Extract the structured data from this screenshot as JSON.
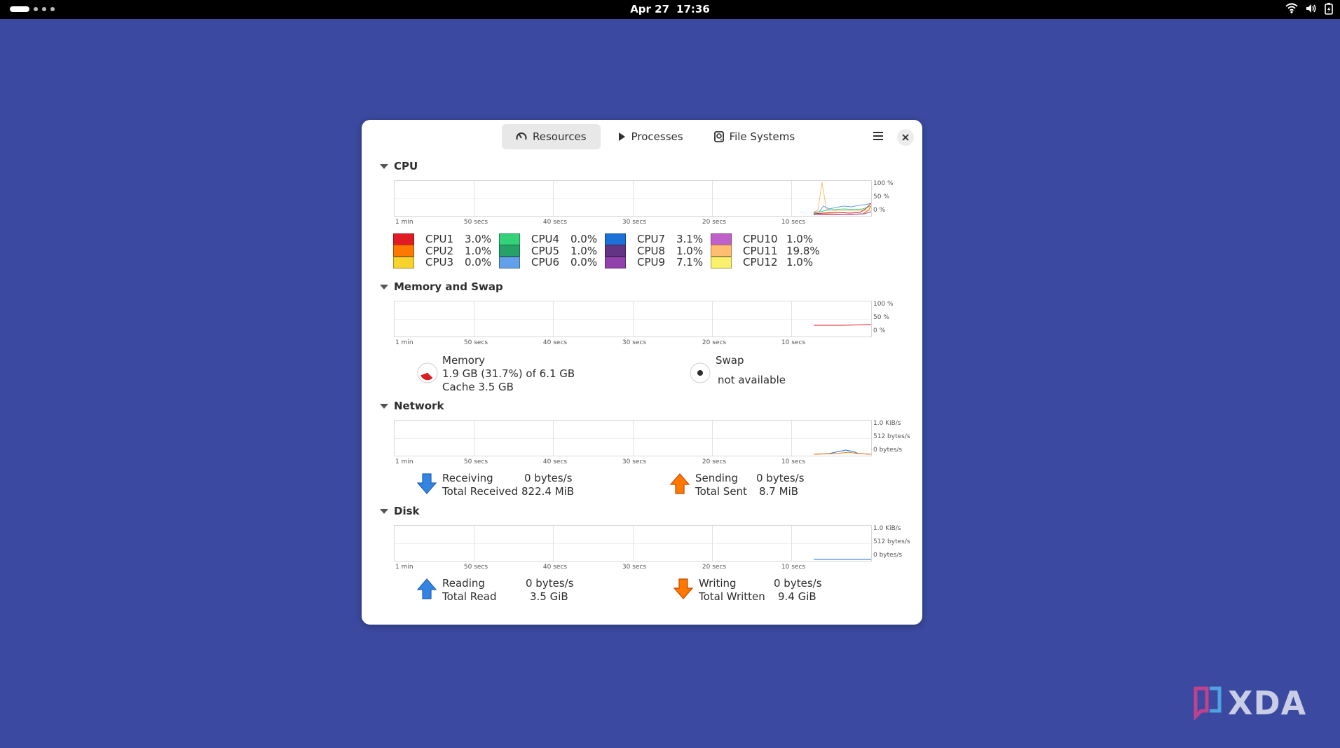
{
  "topbar": {
    "date": "Apr 27",
    "time": "17:36"
  },
  "tabs": [
    {
      "label": "Resources",
      "icon": "gauge-icon",
      "selected": true
    },
    {
      "label": "Processes",
      "icon": "play-icon",
      "selected": false
    },
    {
      "label": "File Systems",
      "icon": "disk-icon",
      "selected": false
    }
  ],
  "x_axis_labels": [
    "1 min",
    "50 secs",
    "40 secs",
    "30 secs",
    "20 secs",
    "10 secs"
  ],
  "cpu": {
    "title": "CPU",
    "y_labels": [
      "100 %",
      "50 %",
      "0 %"
    ],
    "items": [
      {
        "name": "CPU1",
        "value": "3.0%",
        "color": "#e01b24"
      },
      {
        "name": "CPU2",
        "value": "1.0%",
        "color": "#ff7800"
      },
      {
        "name": "CPU3",
        "value": "0.0%",
        "color": "#f6d32d"
      },
      {
        "name": "CPU4",
        "value": "0.0%",
        "color": "#33d17a"
      },
      {
        "name": "CPU5",
        "value": "1.0%",
        "color": "#26a269"
      },
      {
        "name": "CPU6",
        "value": "0.0%",
        "color": "#62a0ea"
      },
      {
        "name": "CPU7",
        "value": "3.1%",
        "color": "#1c71d8"
      },
      {
        "name": "CPU8",
        "value": "1.0%",
        "color": "#613583"
      },
      {
        "name": "CPU9",
        "value": "7.1%",
        "color": "#9141ac"
      },
      {
        "name": "CPU10",
        "value": "1.0%",
        "color": "#c061cb"
      },
      {
        "name": "CPU11",
        "value": "19.8%",
        "color": "#ffbe6f"
      },
      {
        "name": "CPU12",
        "value": "1.0%",
        "color": "#f9f06b"
      }
    ]
  },
  "memory": {
    "title": "Memory and Swap",
    "y_labels": [
      "100 %",
      "50 %",
      "0 %"
    ],
    "memory_label": "Memory",
    "memory_usage": "1.9 GB (31.7%) of 6.1 GB",
    "memory_cache": "Cache 3.5 GB",
    "memory_fraction": 0.317,
    "memory_color": "#e01b24",
    "swap_label": "Swap",
    "swap_status": "not available"
  },
  "network": {
    "title": "Network",
    "y_labels": [
      "1.0 KiB/s",
      "512 bytes/s",
      "0 bytes/s"
    ],
    "receiving_label": "Receiving",
    "receiving_value": "0 bytes/s",
    "total_received_label": "Total Received",
    "total_received_value": "822.4 MiB",
    "sending_label": "Sending",
    "sending_value": "0 bytes/s",
    "total_sent_label": "Total Sent",
    "total_sent_value": "8.7 MiB"
  },
  "disk": {
    "title": "Disk",
    "y_labels": [
      "1.0 KiB/s",
      "512 bytes/s",
      "0 bytes/s"
    ],
    "reading_label": "Reading",
    "reading_value": "0 bytes/s",
    "total_read_label": "Total Read",
    "total_read_value": "3.5 GiB",
    "writing_label": "Writing",
    "writing_value": "0 bytes/s",
    "total_written_label": "Total Written",
    "total_written_value": "9.4 GiB"
  },
  "watermark": {
    "text": "XDA"
  }
}
